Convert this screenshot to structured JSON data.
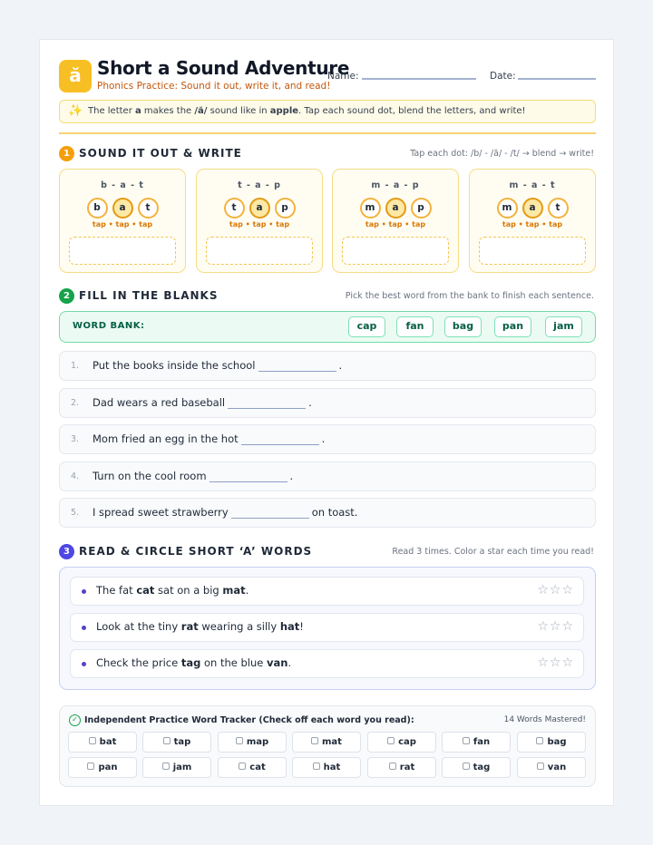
{
  "header": {
    "logo_glyph": "ă",
    "title": "Short a Sound Adventure",
    "subtitle": "Phonics Practice: Sound it out, write it, and read!",
    "name_label": "Name:",
    "date_label": "Date:"
  },
  "tip": {
    "icon": "sparkle-icon",
    "text_1": "The letter ",
    "letter": "a",
    "text_2": " makes the ",
    "sound": "/ă/",
    "text_3": " sound like in ",
    "example": "apple",
    "text_4": ". Tap each sound dot, blend the letters, and write!"
  },
  "section1": {
    "number": "1",
    "title": "SOUND IT OUT & WRITE",
    "note": "Tap each dot: /b/ - /ă/ - /t/ → blend → write!",
    "tap_hint": "tap • tap • tap",
    "cards": [
      {
        "word": "b - a - t",
        "letters": [
          "b",
          "a",
          "t"
        ]
      },
      {
        "word": "t - a - p",
        "letters": [
          "t",
          "a",
          "p"
        ]
      },
      {
        "word": "m - a - p",
        "letters": [
          "m",
          "a",
          "p"
        ]
      },
      {
        "word": "m - a - t",
        "letters": [
          "m",
          "a",
          "t"
        ]
      }
    ]
  },
  "section2": {
    "number": "2",
    "title": "FILL IN THE BLANKS",
    "note": "Pick the best word from the bank to finish each sentence.",
    "bank_label": "WORD BANK:",
    "bank_words": [
      "cap",
      "fan",
      "bag",
      "pan",
      "jam"
    ],
    "sentences": [
      {
        "num": "1.",
        "before": "Put the books inside the school",
        "after": "."
      },
      {
        "num": "2.",
        "before": "Dad wears a red baseball",
        "after": "."
      },
      {
        "num": "3.",
        "before": "Mom fried an egg in the hot",
        "after": "."
      },
      {
        "num": "4.",
        "before": "Turn on the cool room",
        "after": "."
      },
      {
        "num": "5.",
        "before": "I spread sweet strawberry",
        "after": "on toast."
      }
    ]
  },
  "section3": {
    "number": "3",
    "title": "READ & CIRCLE SHORT ‘A’ WORDS",
    "note": "Read 3 times. Color a star each time you read!",
    "stars": "☆☆☆",
    "lines": [
      {
        "t1": "The fat ",
        "b1": "cat",
        "t2": " sat on a big ",
        "b2": "mat",
        "t3": "."
      },
      {
        "t1": "Look at the tiny ",
        "b1": "rat",
        "t2": " wearing a silly ",
        "b2": "hat",
        "t3": "!"
      },
      {
        "t1": "Check the price ",
        "b1": "tag",
        "t2": " on the blue ",
        "b2": "van",
        "t3": "."
      }
    ]
  },
  "tracker": {
    "icon": "check-circle-icon",
    "check_glyph": "✓",
    "title": "Independent Practice Word Tracker (Check off each word you read):",
    "count": "14 Words Mastered!",
    "words": [
      "bat",
      "tap",
      "map",
      "mat",
      "cap",
      "fan",
      "bag",
      "pan",
      "jam",
      "cat",
      "hat",
      "rat",
      "tag",
      "van"
    ]
  },
  "colors": {
    "accent_yellow": "#f8bf24",
    "section1": "#f59e0b",
    "section2": "#16a34a",
    "section3": "#4f46e5"
  }
}
